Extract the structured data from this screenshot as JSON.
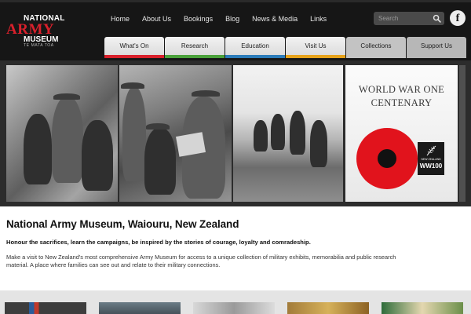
{
  "logo": {
    "line1": "NATIONAL",
    "line2": "ARMY",
    "line3": "MUSEUM",
    "tagline": "TE MATA TOA"
  },
  "top_nav": [
    "Home",
    "About Us",
    "Bookings",
    "Blog",
    "News & Media",
    "Links"
  ],
  "search": {
    "placeholder": "Search",
    "icon": "search-icon"
  },
  "social": {
    "facebook_glyph": "f"
  },
  "main_nav": [
    {
      "label": "What's On",
      "accent": "#d8202b"
    },
    {
      "label": "Research",
      "accent": "#4aa13a"
    },
    {
      "label": "Education",
      "accent": "#2b7bb9"
    },
    {
      "label": "Visit Us",
      "accent": "#e6a21a"
    },
    {
      "label": "Collections",
      "accent": "#c3c3c3"
    },
    {
      "label": "Support Us",
      "accent": "#b7b7b7"
    }
  ],
  "hero": {
    "centenary_line1": "WORLD WAR ONE",
    "centenary_line2": "CENTENARY",
    "badge_country": "NEW ZEALAND",
    "badge_text": "WW100"
  },
  "content": {
    "title": "National Army Museum, Waiouru, New Zealand",
    "subtitle": "Honour the sacrifices, learn the campaigns, be inspired by the stories of courage, loyalty and comradeship.",
    "description": "Make a visit to New Zealand's most comprehensive Army Museum for access to a unique collection of military exhibits, memorabilia and public research material. A place where families can see out and relate to their military connections."
  },
  "colors": {
    "header_bg": "#161616",
    "brand_red": "#d8202b",
    "poppy_red": "#e1131c"
  }
}
